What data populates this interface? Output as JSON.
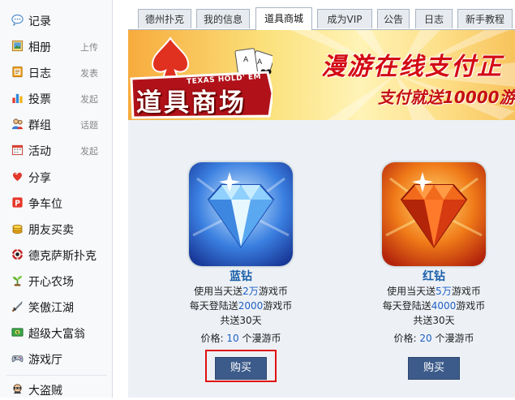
{
  "sidebar": {
    "items": [
      {
        "label": "记录",
        "action": "",
        "icon": "record-icon"
      },
      {
        "label": "相册",
        "action": "上传",
        "icon": "photo-album-icon"
      },
      {
        "label": "日志",
        "action": "发表",
        "icon": "journal-icon"
      },
      {
        "label": "投票",
        "action": "发起",
        "icon": "vote-bar-chart-icon"
      },
      {
        "label": "群组",
        "action": "话题",
        "icon": "group-icon"
      },
      {
        "label": "活动",
        "action": "发起",
        "icon": "event-calendar-icon"
      },
      {
        "label": "分享",
        "action": "",
        "icon": "share-heart-icon"
      },
      {
        "label": "争车位",
        "action": "",
        "icon": "parking-game-icon"
      },
      {
        "label": "朋友买卖",
        "action": "",
        "icon": "coins-icon"
      },
      {
        "label": "德克萨斯扑克",
        "action": "",
        "icon": "poker-chip-icon"
      },
      {
        "label": "开心农场",
        "action": "",
        "icon": "sprout-icon"
      },
      {
        "label": "笑傲江湖",
        "action": "",
        "icon": "sword-icon"
      },
      {
        "label": "超级大富翁",
        "action": "",
        "icon": "money-icon"
      },
      {
        "label": "游戏厅",
        "action": "",
        "icon": "gamepad-icon"
      },
      {
        "label": "大盗贼",
        "action": "",
        "icon": "thief-icon"
      }
    ]
  },
  "tabs": [
    {
      "label": "德州扑克",
      "active": false
    },
    {
      "label": "我的信息",
      "active": false
    },
    {
      "label": "道具商城",
      "active": true
    },
    {
      "label": "成为VIP",
      "active": false
    },
    {
      "label": "公告",
      "active": false
    },
    {
      "label": "日志",
      "active": false
    },
    {
      "label": "新手教程",
      "active": false
    }
  ],
  "banner": {
    "brand_sub": "TEXAS HOLD' EM",
    "brand_title": "道具商场",
    "headline": "漫游在线支付正",
    "subline": "支付就送10000游",
    "colors": {
      "headline": "#d30a14",
      "background": "#fbe07a"
    }
  },
  "products": [
    {
      "name": "蓝钻",
      "line1_pre": "使用当天送",
      "line1_value": "2万",
      "line1_post": "游戏币",
      "line2_pre": "每天登陆送",
      "line2_value": "2000",
      "line2_post": "游戏币",
      "line3": "共送30天",
      "price_label": "价格:",
      "price_value": "10",
      "price_unit": "个漫游币",
      "buy_label": "购买",
      "icon": "blue-diamond-icon",
      "color": "#3a6fd8"
    },
    {
      "name": "红钻",
      "line1_pre": "使用当天送",
      "line1_value": "5万",
      "line1_post": "游戏币",
      "line2_pre": "每天登陆送",
      "line2_value": "4000",
      "line2_post": "游戏币",
      "line3": "共送30天",
      "price_label": "价格:",
      "price_value": "20",
      "price_unit": "个漫游币",
      "buy_label": "购买",
      "icon": "red-diamond-icon",
      "color": "#e24a12"
    }
  ]
}
